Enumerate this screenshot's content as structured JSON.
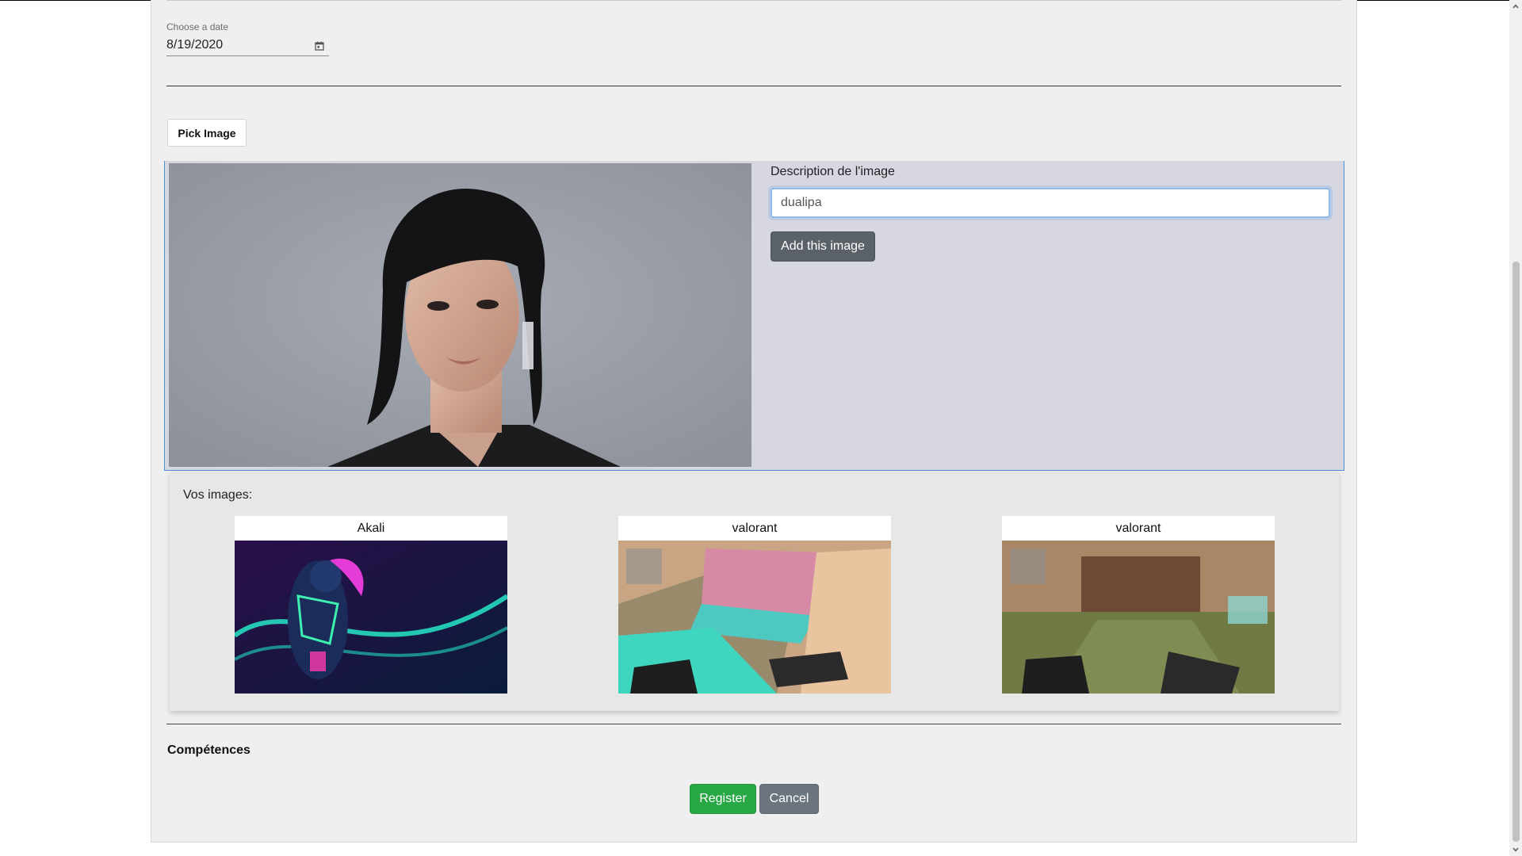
{
  "form": {
    "date_label": "Choose a date",
    "date_value": "8/19/2020",
    "pick_image_label": "Pick Image"
  },
  "upload": {
    "description_label": "Description de l'image",
    "description_value": "dualipa",
    "add_button_label": "Add this image"
  },
  "gallery": {
    "title": "Vos images:",
    "items": [
      {
        "caption": "Akali",
        "picture": "neon-character-art"
      },
      {
        "caption": "valorant",
        "picture": "game-screenshot"
      },
      {
        "caption": "valorant",
        "picture": "game-screenshot"
      }
    ]
  },
  "skills": {
    "title": "Compétences"
  },
  "actions": {
    "register_label": "Register",
    "cancel_label": "Cancel"
  },
  "colors": {
    "card_bg": "#efefef",
    "panel_bg": "#d6d7e1",
    "focus_border": "#4b8fd6",
    "register_green": "#28a745",
    "secondary_gray": "#6c757d"
  },
  "icons": {
    "date": "calendar-icon",
    "scroll_up": "chevron-up-icon",
    "scroll_down": "chevron-down-icon"
  }
}
